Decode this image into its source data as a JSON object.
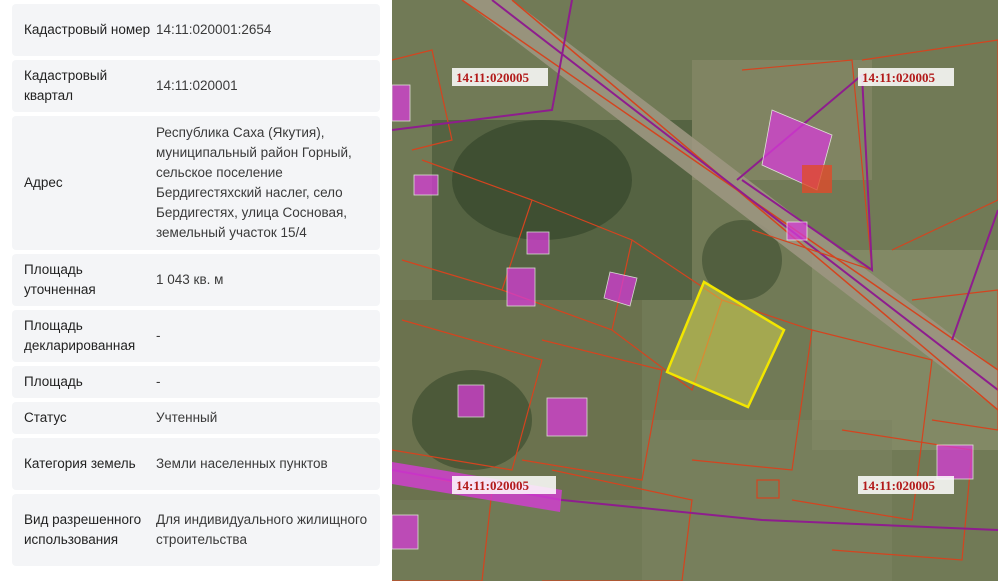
{
  "info_panel": {
    "rows": [
      {
        "label": "Кадастровый номер",
        "value": "14:11:020001:2654"
      },
      {
        "label": "Кадастровый квартал",
        "value": "14:11:020001"
      },
      {
        "label": "Адрес",
        "value": "Республика Саха (Якутия), муниципальный район Горный, сельское поселение Бердигестяхский наслег, село Бердигестях, улица Сосновая, земельный участок 15/4"
      },
      {
        "label": "Площадь уточненная",
        "value": "1 043 кв. м"
      },
      {
        "label": "Площадь декларированная",
        "value": "-"
      },
      {
        "label": "Площадь",
        "value": "-"
      },
      {
        "label": "Статус",
        "value": "Учтенный"
      },
      {
        "label": "Категория земель",
        "value": "Земли населенных пунктов"
      },
      {
        "label": "Вид разрешенного использования",
        "value": "Для индивидуального жилищного строительства"
      }
    ]
  },
  "map": {
    "labels": {
      "top_left": "14:11:020005",
      "top_right": "14:11:020005",
      "bottom_middle": "14:11:020005",
      "bottom_right": "14:11:020005"
    },
    "colors": {
      "parcel_border": "#d4441f",
      "block_border": "#8e1d8e",
      "building_fill": "#d63cd6",
      "selected_parcel_fill": "#e3e04a",
      "selected_parcel_border": "#f2e600",
      "label_color": "#b21a1a"
    }
  }
}
